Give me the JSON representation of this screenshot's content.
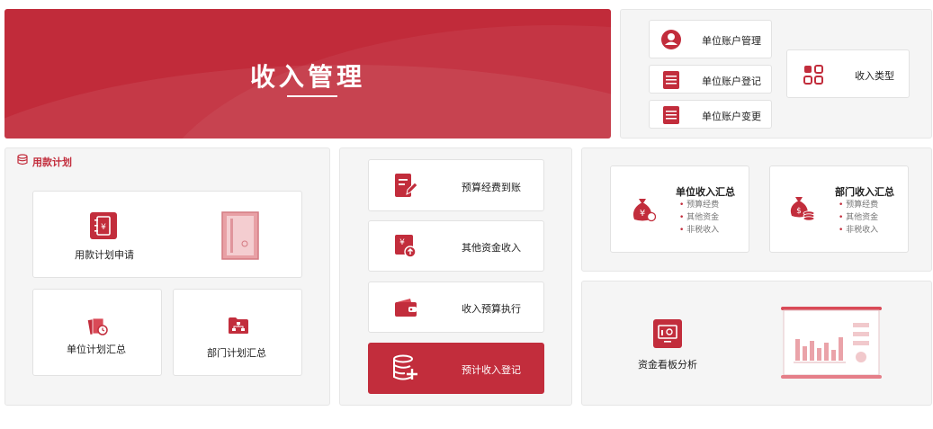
{
  "banner": {
    "title": "收入管理"
  },
  "account": {
    "manage": "单位账户管理",
    "register": "单位账户登记",
    "change": "单位账户变更",
    "income_type": "收入类型"
  },
  "plan": {
    "section_title": "用款计划",
    "apply": "用款计划申请",
    "unit_summary": "单位计划汇总",
    "dept_summary": "部门计划汇总"
  },
  "actions": {
    "budget_arrival": "预算经费到账",
    "other_income": "其他资金收入",
    "budget_execution": "收入预算执行",
    "estimated_income": "预计收入登记"
  },
  "summary": {
    "unit": {
      "title": "单位收入汇总",
      "items": [
        "预算经费",
        "其他资金",
        "非税收入"
      ]
    },
    "dept": {
      "title": "部门收入汇总",
      "items": [
        "预算经费",
        "其他资金",
        "非税收入"
      ]
    }
  },
  "dashboard": {
    "label": "资金看板分析"
  },
  "colors": {
    "accent": "#c22d3c",
    "banner": "#c12b3a",
    "panel": "#f5f5f5"
  }
}
